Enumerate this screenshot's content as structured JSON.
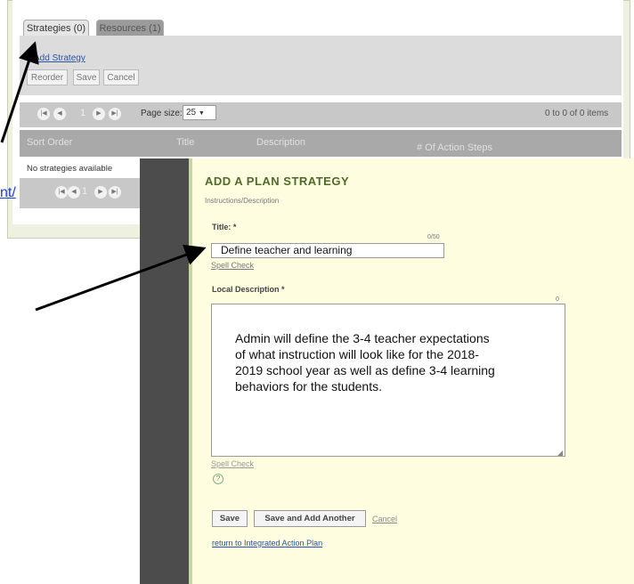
{
  "tabs": [
    {
      "label": "Strategies (0)"
    },
    {
      "label": "Resources (1)"
    }
  ],
  "list_panel": {
    "add_link": "Add Strategy",
    "toolbar": {
      "reorder": "Reorder",
      "save": "Save",
      "cancel": "Cancel"
    },
    "pager": {
      "page": "1",
      "page_size_label": "Page size:",
      "page_size": "25",
      "items_info": "0 to 0 of 0 items"
    },
    "columns": [
      "Sort Order",
      "Title",
      "Description",
      "# Of Action Steps"
    ],
    "empty_message": "No strategies available"
  },
  "link_fragment": "nt/",
  "form": {
    "title": "ADD A PLAN STRATEGY",
    "instructions": "Instructions/Description",
    "title_label": "Title: *",
    "title_counter": "0/50",
    "title_value": "Define teacher and learning",
    "spell_check": "Spell Check",
    "desc_label": "Local Description *",
    "desc_counter": "0",
    "desc_value": "Admin will define the 3-4 teacher expectations of what instruction will look like for the 2018-2019 school year as well as define 3-4 learning behaviors for the students.",
    "spell_check_2": "Spell Check",
    "help": "?",
    "buttons": {
      "save": "Save",
      "save_add": "Save and Add Another",
      "cancel": "Cancel"
    },
    "return_link": "return to Integrated Action Plan"
  },
  "colors": {
    "form_title": "#4f6b2a",
    "form_bg": "#fefde0",
    "link": "#2a55a0",
    "url_link": "#1f3fd1"
  }
}
